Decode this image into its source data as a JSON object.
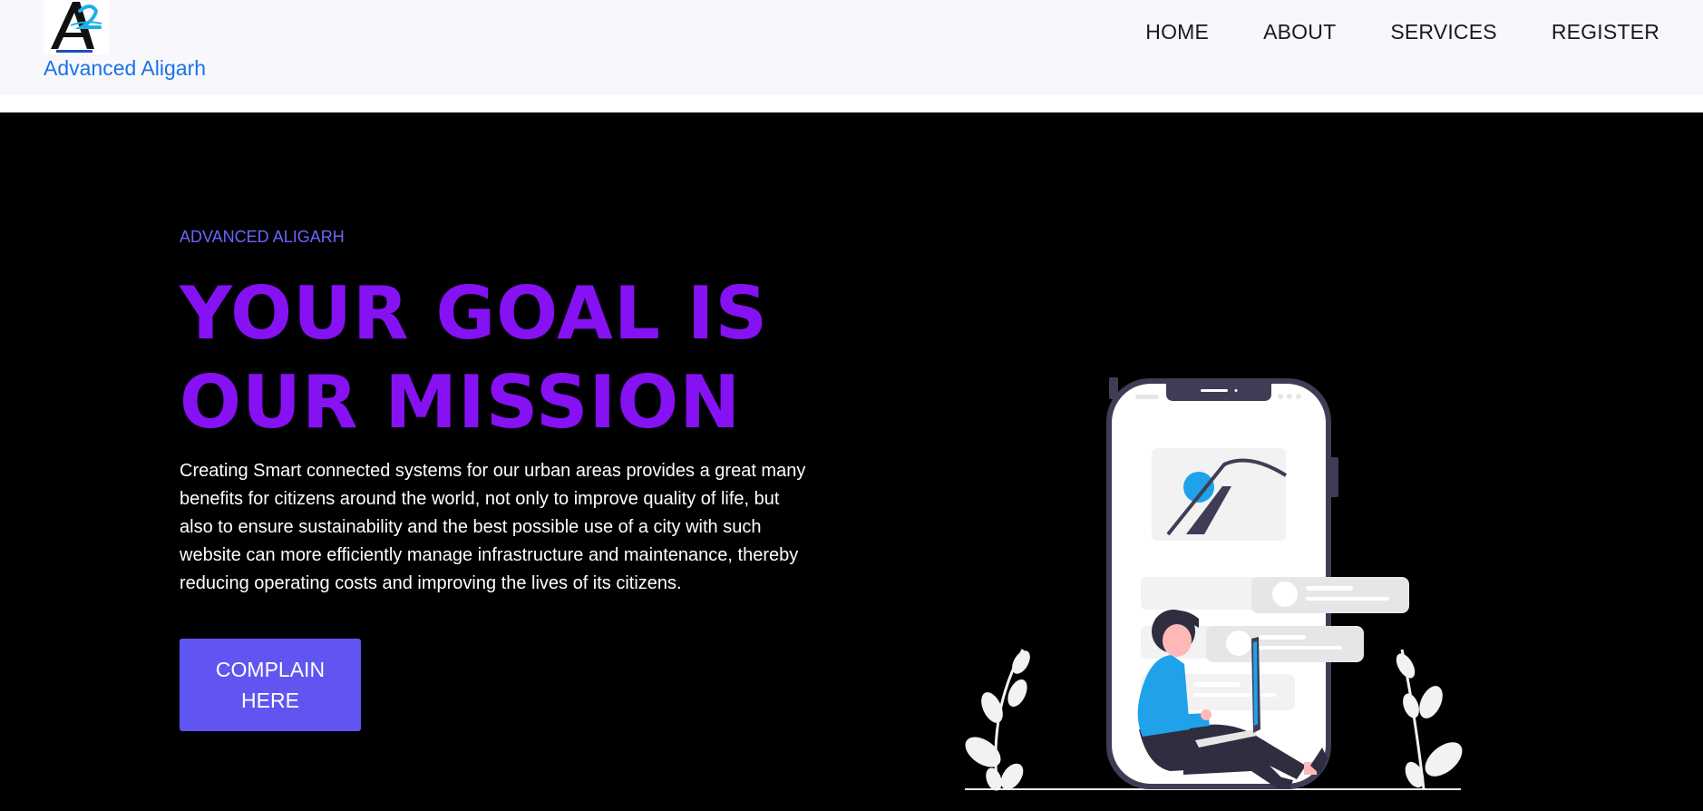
{
  "header": {
    "brand_name": "Advanced Aligarh",
    "logo_alt": "Advanced Aligarh logo",
    "nav_items": [
      "HOME",
      "ABOUT",
      "SERVICES",
      "REGISTER"
    ]
  },
  "hero": {
    "kicker": "ADVANCED ALIGARH",
    "headline": "YOUR GOAL IS OUR MISSION",
    "intro": "Creating Smart connected systems for our urban areas provides a great many benefits for citizens around the world, not only to improve quality of life, but also to ensure sustainability and the best possible use of a city with such website can more efficiently manage infrastructure and maintenance, thereby reducing operating costs and improving the lives of its citizens.",
    "cta_label": "COMPLAIN\nHERE"
  },
  "illustration": {
    "alt": "Person sitting with a laptop in front of a large smartphone"
  },
  "colors": {
    "brand_blue": "#1a73e8",
    "kicker": "#6c63ff",
    "headline": "#8611f3",
    "cta": "#6155f2",
    "hero_bg": "#000000",
    "nav_bg": "#f8f8fc"
  }
}
